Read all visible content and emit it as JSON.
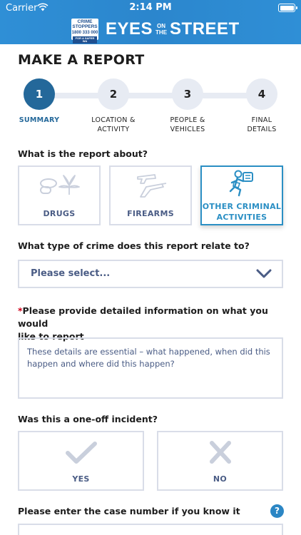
{
  "status_bar": {
    "carrier": "Carrier",
    "time": "2:14 PM"
  },
  "header": {
    "logo": {
      "line1": "CRIME",
      "line2": "STOPPERS",
      "phone": "1800 333 000",
      "tagline": "FOR A SAFER WA"
    },
    "brand": {
      "word1": "EYES",
      "on": "ON",
      "the": "THE",
      "word2": "STREET"
    }
  },
  "page_title": "MAKE A REPORT",
  "steps": [
    {
      "number": "1",
      "label_line1": "SUMMARY",
      "label_line2": "",
      "active": true
    },
    {
      "number": "2",
      "label_line1": "LOCATION &",
      "label_line2": "ACTIVITY",
      "active": false
    },
    {
      "number": "3",
      "label_line1": "PEOPLE &",
      "label_line2": "VEHICLES",
      "active": false
    },
    {
      "number": "4",
      "label_line1": "FINAL",
      "label_line2": "DETAILS",
      "active": false
    }
  ],
  "report_about": {
    "question": "What is the report about?",
    "options": [
      {
        "label": "DRUGS",
        "icon": "drugs-icon",
        "selected": false
      },
      {
        "label": "FIREARMS",
        "icon": "firearms-icon",
        "selected": false
      },
      {
        "label_line1": "OTHER CRIMINAL",
        "label_line2": "ACTIVITIES",
        "icon": "burglar-icon",
        "selected": true
      }
    ]
  },
  "crime_type": {
    "question": "What type of crime does this report relate to?",
    "value": "Please select..."
  },
  "details": {
    "star": "*",
    "question_line1": "Please provide detailed information on what you would",
    "question_line2": "like to report",
    "placeholder": "These details are essential – what happened, when did this happen and where did this happen?"
  },
  "one_off": {
    "question": "Was this a one-off incident?",
    "yes_label": "YES",
    "no_label": "NO"
  },
  "case_number": {
    "question": "Please enter the case number if you know it",
    "help": "?"
  },
  "colors": {
    "header_blue": "#2f8fd6",
    "active_step": "#24689a",
    "selected_border": "#2b8fc4",
    "muted_text": "#4a5c85",
    "required": "#d0021b"
  }
}
